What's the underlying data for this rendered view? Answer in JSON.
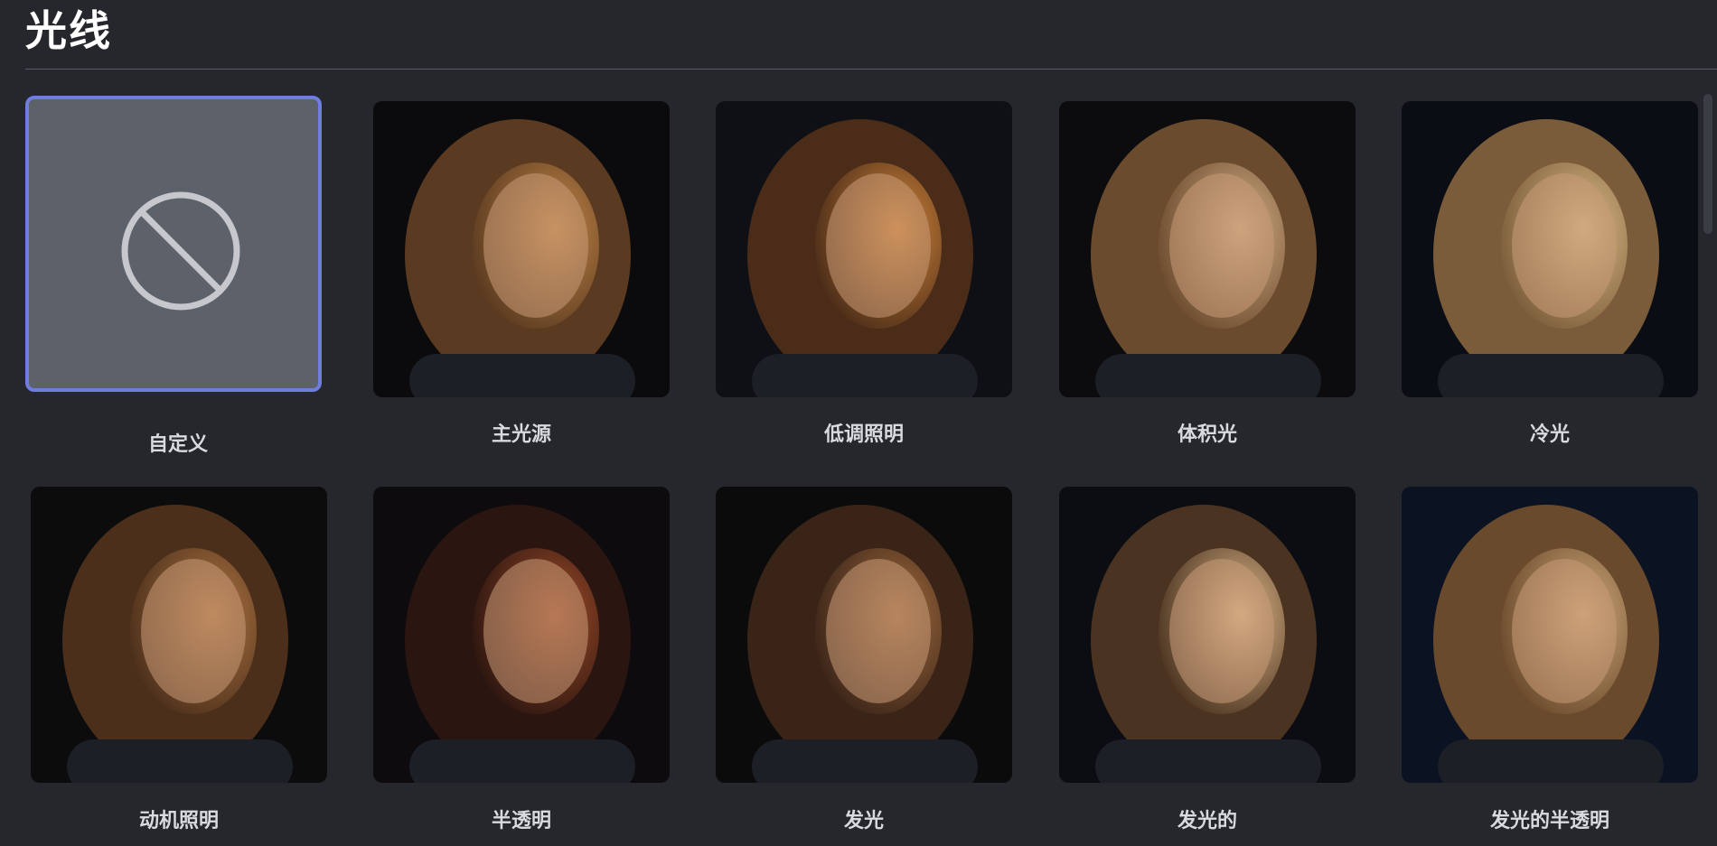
{
  "section": {
    "title": "光线"
  },
  "options": [
    {
      "label": "自定义",
      "selected": true,
      "icon": "no-style-icon"
    },
    {
      "label": "主光源",
      "selected": false,
      "bg": "#0b0b0d",
      "hair": "#5a3a20",
      "light": "#c98b4a"
    },
    {
      "label": "低调照明",
      "selected": false,
      "bg": "#0e1016",
      "hair": "#4a2c18",
      "light": "#d98a3c"
    },
    {
      "label": "体积光",
      "selected": false,
      "bg": "#0c0c0e",
      "hair": "#6b4b2e",
      "light": "#d9b38a"
    },
    {
      "label": "冷光",
      "selected": false,
      "bg": "#0a0d14",
      "hair": "#7a5c3a",
      "light": "#e0c08a"
    },
    {
      "label": "动机照明",
      "selected": false,
      "bg": "#0c0c0c",
      "hair": "#4b2f1b",
      "light": "#b77a44"
    },
    {
      "label": "半透明",
      "selected": false,
      "bg": "#0d0b0d",
      "hair": "#2b1510",
      "light": "#a8502a"
    },
    {
      "label": "发光",
      "selected": false,
      "bg": "#0b0b0c",
      "hair": "#3a2418",
      "light": "#a87040"
    },
    {
      "label": "发光的",
      "selected": false,
      "bg": "#0b0d12",
      "hair": "#4a3320",
      "light": "#e8c090"
    },
    {
      "label": "发光的半透明",
      "selected": false,
      "bg": "#0b1222",
      "hair": "#6a4a2c",
      "light": "#d8b080"
    }
  ]
}
